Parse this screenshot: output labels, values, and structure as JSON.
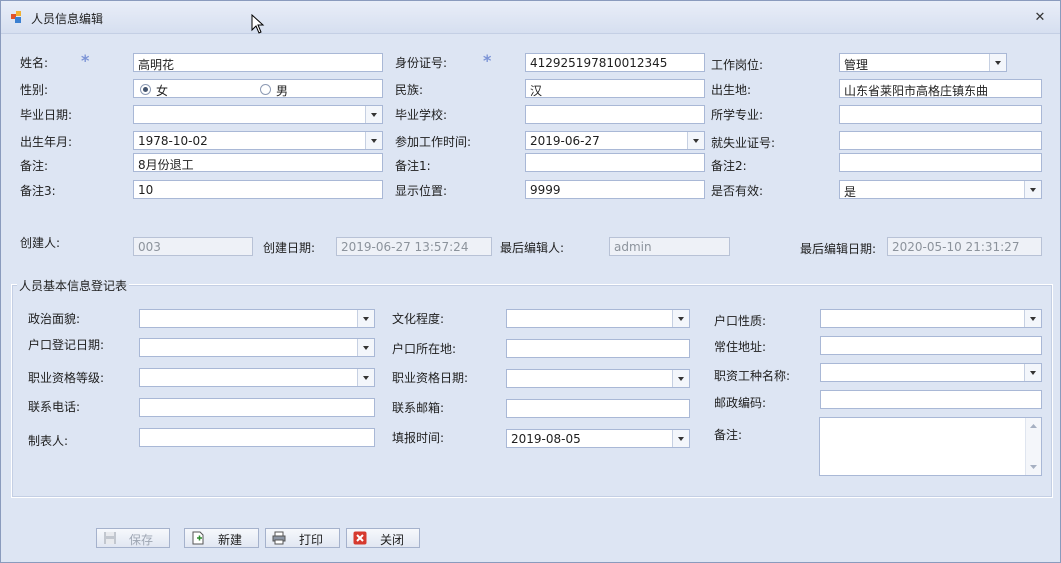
{
  "window": {
    "title": "人员信息编辑"
  },
  "form": {
    "name_label": "姓名:",
    "name_value": "高明花",
    "id_label": "身份证号:",
    "id_value": "412925197810012345",
    "job_label": "工作岗位:",
    "job_value": "管理",
    "gender_label": "性别:",
    "gender_female": "女",
    "gender_male": "男",
    "gender_selected": "女",
    "ethnic_label": "民族:",
    "ethnic_value": "汉",
    "birthplace_label": "出生地:",
    "birthplace_value": "山东省莱阳市高格庄镇东曲",
    "grad_date_label": "毕业日期:",
    "grad_date_value": "",
    "school_label": "毕业学校:",
    "school_value": "",
    "major_label": "所学专业:",
    "major_value": "",
    "birth_label": "出生年月:",
    "birth_value": "1978-10-02",
    "workstart_label": "参加工作时间:",
    "workstart_value": "2019-06-27",
    "employ_cert_label": "就失业证号:",
    "employ_cert_value": "",
    "note_label": "备注:",
    "note_value": "8月份退工",
    "note1_label": "备注1:",
    "note1_value": "",
    "note2_label": "备注2:",
    "note2_value": "",
    "note3_label": "备注3:",
    "note3_value": "10",
    "display_pos_label": "显示位置:",
    "display_pos_value": "9999",
    "valid_label": "是否有效:",
    "valid_value": "是",
    "creator_label": "创建人:",
    "creator_value": "003",
    "created_date_label": "创建日期:",
    "created_date_value": "2019-06-27 13:57:24",
    "last_editor_label": "最后编辑人:",
    "last_editor_value": "admin",
    "last_edit_date_label": "最后编辑日期:",
    "last_edit_date_value": "2020-05-10 21:31:27"
  },
  "group": {
    "title": "人员基本信息登记表",
    "political_label": "政治面貌:",
    "political_value": "",
    "education_label": "文化程度:",
    "education_value": "",
    "hukou_type_label": "户口性质:",
    "hukou_type_value": "",
    "hukou_reg_date_label": "户口登记日期:",
    "hukou_reg_date_value": "",
    "hukou_loc_label": "户口所在地:",
    "hukou_loc_value": "",
    "address_label": "常住地址:",
    "address_value": "",
    "qual_level_label": "职业资格等级:",
    "qual_level_value": "",
    "qual_date_label": "职业资格日期:",
    "qual_date_value": "",
    "job_type_label": "职资工种名称:",
    "job_type_value": "",
    "phone_label": "联系电话:",
    "phone_value": "",
    "email_label": "联系邮箱:",
    "email_value": "",
    "postcode_label": "邮政编码:",
    "postcode_value": "",
    "maker_label": "制表人:",
    "maker_value": "",
    "fill_time_label": "填报时间:",
    "fill_time_value": "2019-08-05",
    "remark_label": "备注:",
    "remark_value": ""
  },
  "buttons": {
    "save": "保存",
    "new": "新建",
    "print": "打印",
    "close": "关闭"
  },
  "colors": {
    "accent_star": "#7b93d6",
    "background": "#dde5f3",
    "border": "#a9b8d6"
  },
  "icons": [
    "app-icon",
    "close-icon",
    "mouse-cursor-icon",
    "save-icon",
    "new-document-icon",
    "printer-icon",
    "close-red-icon"
  ]
}
